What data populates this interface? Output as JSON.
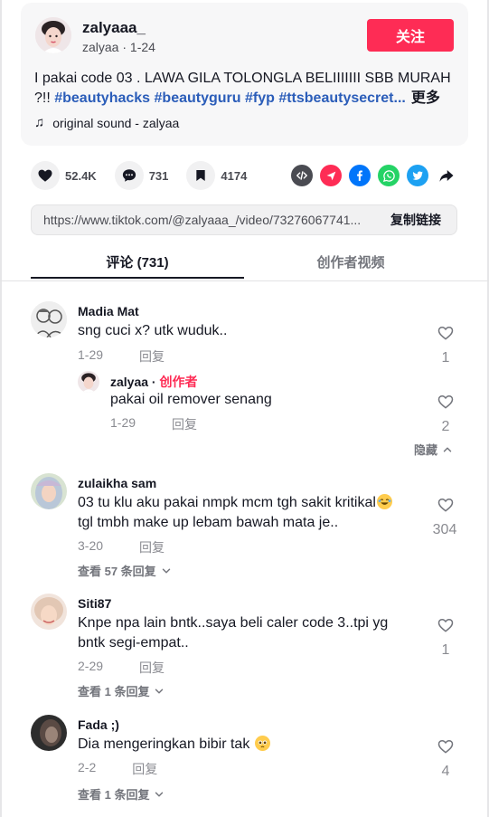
{
  "post": {
    "author_name": "zalyaaa_",
    "author_sub": "zalyaa · 1-24",
    "follow_label": "关注",
    "caption": "I pakai code 03 . LAWA GILA TOLONGLA BELIIIIIII SBB MURAH ?!! ",
    "hashtags": "#beautyhacks #beautyguru #fyp #ttsbeautysecret...",
    "more_label": "更多",
    "sound": "original sound - zalyaa"
  },
  "stats": {
    "likes": "52.4K",
    "comments": "731",
    "saves": "4174"
  },
  "share_icons": [
    "embed-icon",
    "send-icon",
    "facebook-icon",
    "whatsapp-icon",
    "twitter-icon",
    "share-arrow-icon"
  ],
  "link": {
    "url": "https://www.tiktok.com/@zalyaaa_/video/73276067741...",
    "copy_label": "复制链接"
  },
  "tabs": {
    "comments": "评论 (731)",
    "creator_videos": "创作者视频"
  },
  "comments": [
    {
      "name": "Madia Mat",
      "text": "sng cuci x? utk wuduk..",
      "date": "1-29",
      "reply_label": "回复",
      "likes": "1",
      "reply": {
        "name": "zalyaa",
        "sep": " · ",
        "creator_label": "创作者",
        "text": "pakai oil remover senang",
        "date": "1-29",
        "reply_label": "回复",
        "likes": "2"
      },
      "hide_label": "隐藏"
    },
    {
      "name": "zulaikha sam",
      "text_line1": "03 tu klu aku pakai nmpk mcm tgh sakit kritikal",
      "text_line2": "tgl tmbh make up lebam bawah mata je..",
      "date": "3-20",
      "reply_label": "回复",
      "likes": "304",
      "view_replies": "查看 57 条回复"
    },
    {
      "name": "Siti87",
      "text_line1": "Knpe npa lain bntk..saya beli caler code 3..tpi yg",
      "text_line2": "bntk segi-empat..",
      "date": "2-29",
      "reply_label": "回复",
      "likes": "1",
      "view_replies": "查看 1 条回复"
    },
    {
      "name": "Fada ;)",
      "text": "Dia mengeringkan bibir tak",
      "date": "2-2",
      "reply_label": "回复",
      "likes": "4",
      "view_replies": "查看 1 条回复"
    }
  ],
  "colors": {
    "accent": "#fe2c55",
    "hashtag": "#2b5db9",
    "facebook": "#0075fa",
    "whatsapp": "#25d366",
    "twitter": "#1da1f2",
    "send": "#fe2c55",
    "embed": "#4a4b52"
  }
}
